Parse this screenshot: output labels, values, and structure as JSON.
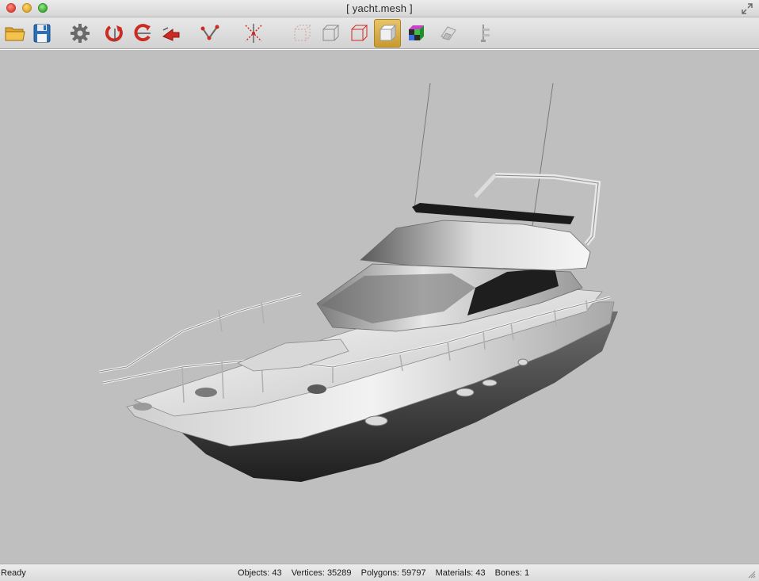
{
  "window": {
    "title": "[ yacht.mesh ]"
  },
  "toolbar": {
    "buttons": [
      {
        "name": "open-file",
        "icon": "folder-icon"
      },
      {
        "name": "save-file",
        "icon": "floppy-disk-icon"
      },
      {
        "name": "settings",
        "icon": "gear-icon"
      },
      {
        "name": "rotate-x",
        "icon": "rotate-x-icon"
      },
      {
        "name": "rotate-y",
        "icon": "rotate-y-icon"
      },
      {
        "name": "rotate-z",
        "icon": "rotate-z-icon"
      },
      {
        "name": "vertices",
        "icon": "vertex-path-icon"
      },
      {
        "name": "bounding-center",
        "icon": "center-cross-icon"
      },
      {
        "name": "view-points",
        "icon": "cube-points-icon"
      },
      {
        "name": "view-wireframe",
        "icon": "cube-wireframe-icon"
      },
      {
        "name": "view-wireframe-red",
        "icon": "cube-wireframe-red-icon"
      },
      {
        "name": "view-shaded",
        "icon": "cube-shaded-icon",
        "active": true
      },
      {
        "name": "view-textured",
        "icon": "cube-textured-icon"
      },
      {
        "name": "view-uv",
        "icon": "uv-map-icon"
      },
      {
        "name": "view-bones",
        "icon": "bone-hierarchy-icon"
      }
    ]
  },
  "status": {
    "text": "Ready",
    "objects_label": "Objects: 43",
    "vertices_label": "Vertices: 35289",
    "polygons_label": "Polygons: 59797",
    "materials_label": "Materials: 43",
    "bones_label": "Bones: 1"
  },
  "colors": {
    "viewport_background": "#bfbfbf",
    "active_button": "#d8ae48"
  }
}
